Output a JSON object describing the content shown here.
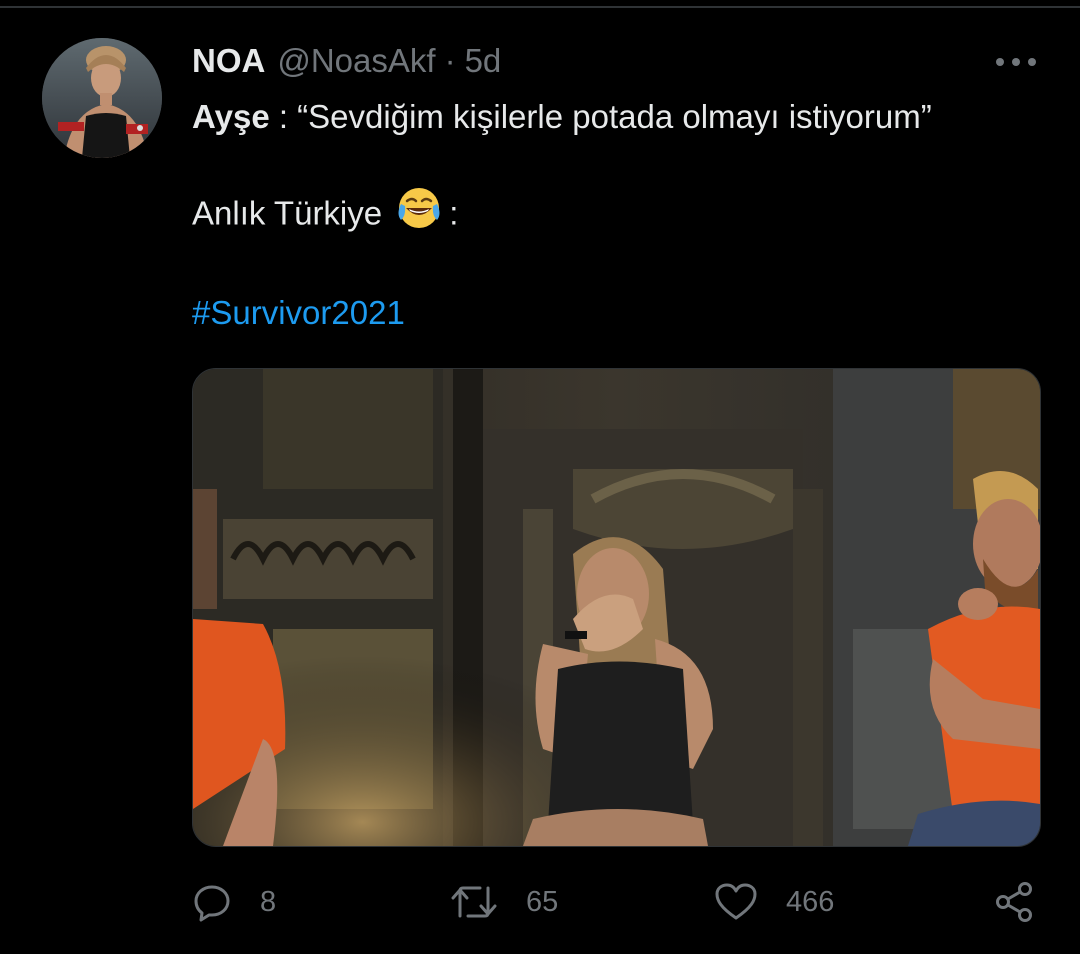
{
  "tweet": {
    "author": {
      "display_name": "NOA",
      "handle": "@NoasAkf",
      "separator": "·",
      "time": "5d",
      "avatar_icon": "profile-photo"
    },
    "line1": {
      "speaker": "Ayşe",
      "quote": " : “Sevdiğim kişilerle potada olmayı istiyorum”"
    },
    "line2": {
      "text": "Anlık Türkiye",
      "emoji": "face-with-tears-of-joy",
      "suffix": ":"
    },
    "hashtag": "#Survivor2021",
    "media": {
      "type": "video-still"
    },
    "actions": {
      "reply_count": "8",
      "retweet_count": "65",
      "like_count": "466",
      "reply_icon": "reply-icon",
      "retweet_icon": "retweet-icon",
      "like_icon": "heart-icon",
      "share_icon": "share-icon"
    }
  },
  "colors": {
    "background": "#000000",
    "text": "#e7e9ea",
    "secondary": "#71767b",
    "link": "#1d9bf0",
    "divider": "#2f3336"
  }
}
